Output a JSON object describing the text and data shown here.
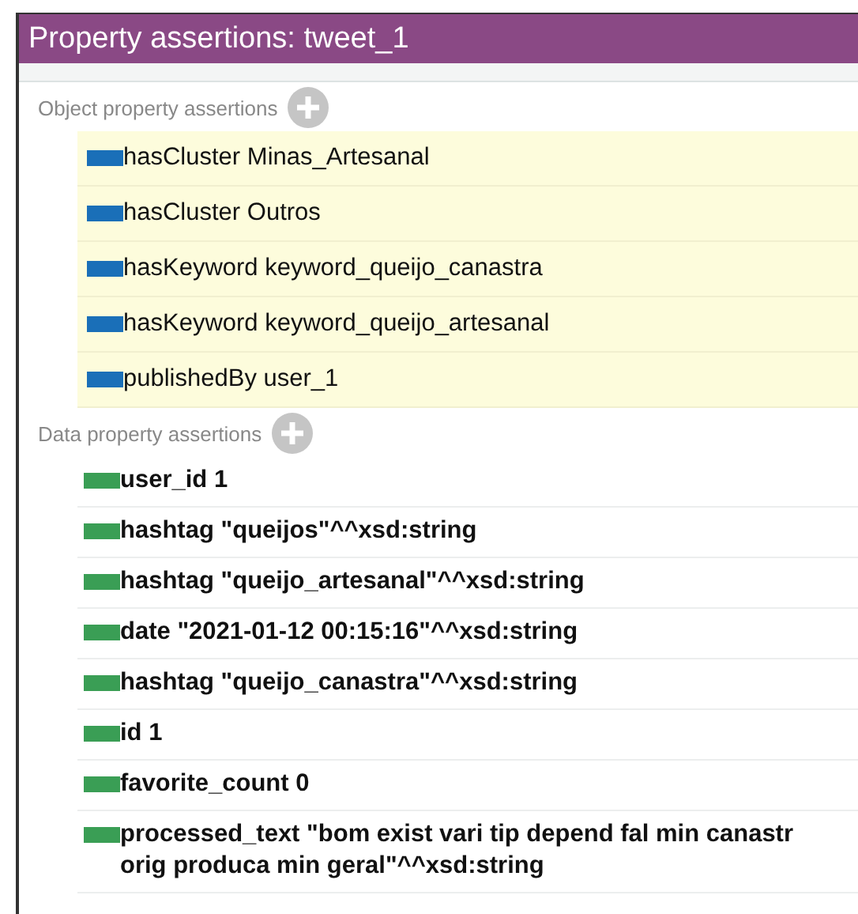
{
  "window": {
    "title": "Property assertions: tweet_1"
  },
  "sections": [
    {
      "kind": "object",
      "heading": "Object property assertions",
      "rows": [
        {
          "property": "hasCluster",
          "value": "Minas_Artesanal"
        },
        {
          "property": "hasCluster",
          "value": "Outros"
        },
        {
          "property": "hasKeyword",
          "value": "keyword_queijo_canastra"
        },
        {
          "property": "hasKeyword",
          "value": "keyword_queijo_artesanal"
        },
        {
          "property": "publishedBy",
          "value": "user_1"
        }
      ]
    },
    {
      "kind": "data",
      "heading": "Data property assertions",
      "rows": [
        {
          "property": "user_id",
          "value": "1"
        },
        {
          "property": "hashtag",
          "value": "\"queijos\"^^xsd:string"
        },
        {
          "property": "hashtag",
          "value": "\"queijo_artesanal\"^^xsd:string"
        },
        {
          "property": "date",
          "value": "\"2021-01-12 00:15:16\"^^xsd:string"
        },
        {
          "property": "hashtag",
          "value": "\"queijo_canastra\"^^xsd:string"
        },
        {
          "property": "id",
          "value": "1"
        },
        {
          "property": "favorite_count",
          "value": "0"
        },
        {
          "property": "processed_text",
          "value": "\"bom exist vari tip depend fal min canastr orig produca min geral\"^^xsd:string"
        }
      ]
    }
  ]
}
